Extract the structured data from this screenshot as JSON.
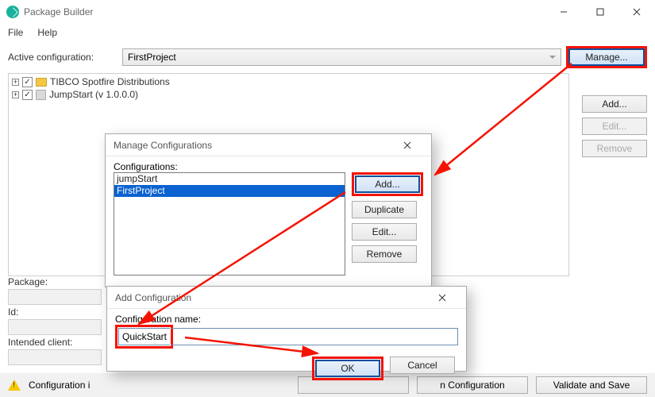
{
  "window": {
    "title": "Package Builder"
  },
  "menu": {
    "file": "File",
    "help": "Help"
  },
  "activeConfig": {
    "label": "Active configuration:",
    "value": "FirstProject",
    "manage": "Manage..."
  },
  "tree": {
    "items": [
      {
        "label": "TIBCO Spotfire Distributions",
        "icon": "folder"
      },
      {
        "label": "JumpStart (v 1.0.0.0)",
        "icon": "package"
      }
    ]
  },
  "sideButtons": {
    "add": "Add...",
    "edit": "Edit...",
    "remove": "Remove"
  },
  "leftFields": {
    "package": "Package:",
    "id": "Id:",
    "client": "Intended client:"
  },
  "bottom": {
    "status": "Configuration i",
    "deploy": "",
    "refresh": "n Configuration",
    "validate": "Validate and Save"
  },
  "dlgManage": {
    "title": "Manage Configurations",
    "listLabel": "Configurations:",
    "items": [
      "jumpStart",
      "FirstProject"
    ],
    "buttons": {
      "add": "Add...",
      "duplicate": "Duplicate",
      "edit": "Edit...",
      "remove": "Remove"
    }
  },
  "dlgAdd": {
    "title": "Add Configuration",
    "nameLabel": "Configuration name:",
    "nameValue": "QuickStart",
    "ok": "OK",
    "cancel": "Cancel"
  }
}
